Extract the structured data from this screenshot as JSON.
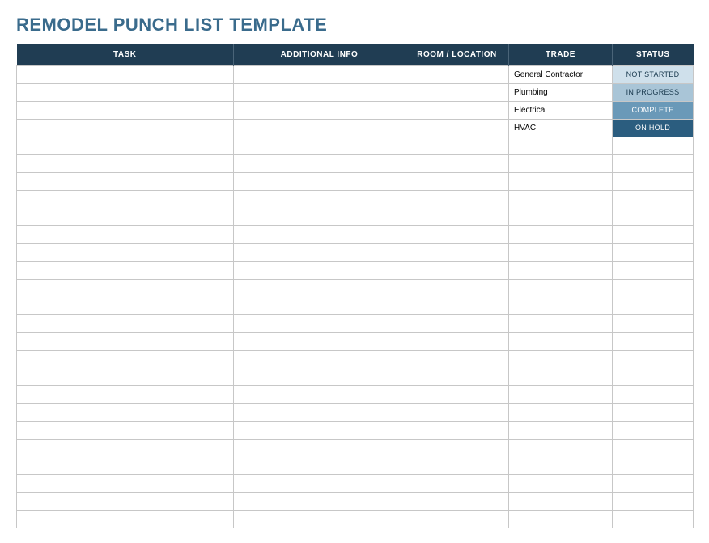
{
  "title": "REMODEL PUNCH LIST TEMPLATE",
  "columns": {
    "task": "TASK",
    "additional_info": "ADDITIONAL INFO",
    "room_location": "ROOM / LOCATION",
    "trade": "TRADE",
    "status": "STATUS"
  },
  "rows": [
    {
      "task": "",
      "info": "",
      "room": "",
      "trade": "General Contractor",
      "status": "NOT STARTED",
      "status_class": "status-not-started"
    },
    {
      "task": "",
      "info": "",
      "room": "",
      "trade": "Plumbing",
      "status": "IN PROGRESS",
      "status_class": "status-in-progress"
    },
    {
      "task": "",
      "info": "",
      "room": "",
      "trade": "Electrical",
      "status": "COMPLETE",
      "status_class": "status-complete"
    },
    {
      "task": "",
      "info": "",
      "room": "",
      "trade": "HVAC",
      "status": "ON HOLD",
      "status_class": "status-on-hold"
    },
    {
      "task": "",
      "info": "",
      "room": "",
      "trade": "",
      "status": "",
      "status_class": ""
    },
    {
      "task": "",
      "info": "",
      "room": "",
      "trade": "",
      "status": "",
      "status_class": ""
    },
    {
      "task": "",
      "info": "",
      "room": "",
      "trade": "",
      "status": "",
      "status_class": ""
    },
    {
      "task": "",
      "info": "",
      "room": "",
      "trade": "",
      "status": "",
      "status_class": ""
    },
    {
      "task": "",
      "info": "",
      "room": "",
      "trade": "",
      "status": "",
      "status_class": ""
    },
    {
      "task": "",
      "info": "",
      "room": "",
      "trade": "",
      "status": "",
      "status_class": ""
    },
    {
      "task": "",
      "info": "",
      "room": "",
      "trade": "",
      "status": "",
      "status_class": ""
    },
    {
      "task": "",
      "info": "",
      "room": "",
      "trade": "",
      "status": "",
      "status_class": ""
    },
    {
      "task": "",
      "info": "",
      "room": "",
      "trade": "",
      "status": "",
      "status_class": ""
    },
    {
      "task": "",
      "info": "",
      "room": "",
      "trade": "",
      "status": "",
      "status_class": ""
    },
    {
      "task": "",
      "info": "",
      "room": "",
      "trade": "",
      "status": "",
      "status_class": ""
    },
    {
      "task": "",
      "info": "",
      "room": "",
      "trade": "",
      "status": "",
      "status_class": ""
    },
    {
      "task": "",
      "info": "",
      "room": "",
      "trade": "",
      "status": "",
      "status_class": ""
    },
    {
      "task": "",
      "info": "",
      "room": "",
      "trade": "",
      "status": "",
      "status_class": ""
    },
    {
      "task": "",
      "info": "",
      "room": "",
      "trade": "",
      "status": "",
      "status_class": ""
    },
    {
      "task": "",
      "info": "",
      "room": "",
      "trade": "",
      "status": "",
      "status_class": ""
    },
    {
      "task": "",
      "info": "",
      "room": "",
      "trade": "",
      "status": "",
      "status_class": ""
    },
    {
      "task": "",
      "info": "",
      "room": "",
      "trade": "",
      "status": "",
      "status_class": ""
    },
    {
      "task": "",
      "info": "",
      "room": "",
      "trade": "",
      "status": "",
      "status_class": ""
    },
    {
      "task": "",
      "info": "",
      "room": "",
      "trade": "",
      "status": "",
      "status_class": ""
    },
    {
      "task": "",
      "info": "",
      "room": "",
      "trade": "",
      "status": "",
      "status_class": ""
    },
    {
      "task": "",
      "info": "",
      "room": "",
      "trade": "",
      "status": "",
      "status_class": ""
    }
  ]
}
